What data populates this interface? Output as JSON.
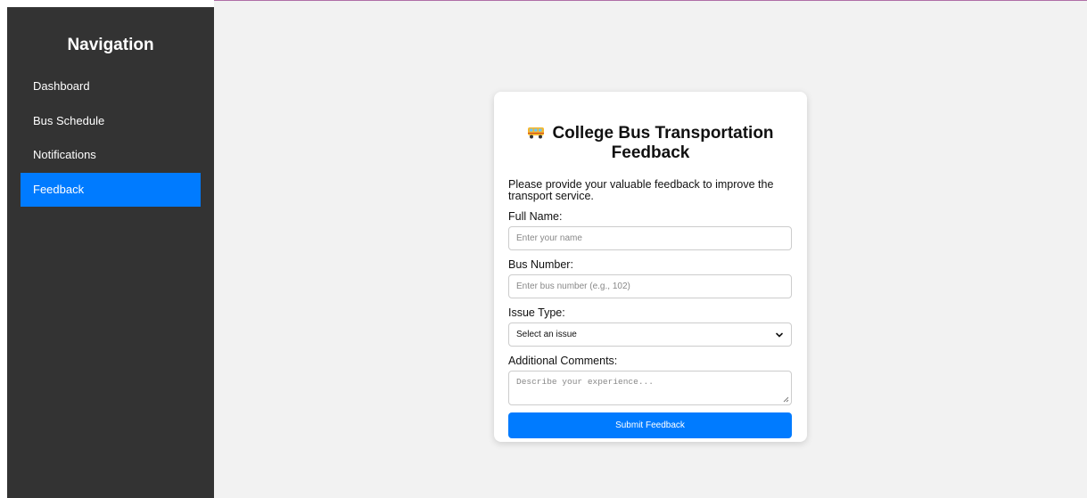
{
  "sidebar": {
    "title": "Navigation",
    "items": [
      {
        "label": "Dashboard"
      },
      {
        "label": "Bus Schedule"
      },
      {
        "label": "Notifications"
      },
      {
        "label": "Feedback",
        "active": true
      }
    ]
  },
  "form": {
    "title_line1": "College Bus Transportation",
    "title_line2": "Feedback",
    "intro": "Please provide your valuable feedback to improve the transport service.",
    "full_name_label": "Full Name:",
    "full_name_placeholder": "Enter your name",
    "bus_number_label": "Bus Number:",
    "bus_number_placeholder": "Enter bus number (e.g., 102)",
    "issue_type_label": "Issue Type:",
    "issue_type_selected": "Select an issue",
    "comments_label": "Additional Comments:",
    "comments_placeholder": "Describe your experience...",
    "submit_label": "Submit Feedback"
  },
  "colors": {
    "sidebar_bg": "#333333",
    "accent": "#007bff",
    "main_bg": "#f2f2f2"
  },
  "icons": {
    "title_icon": "bus-icon"
  }
}
